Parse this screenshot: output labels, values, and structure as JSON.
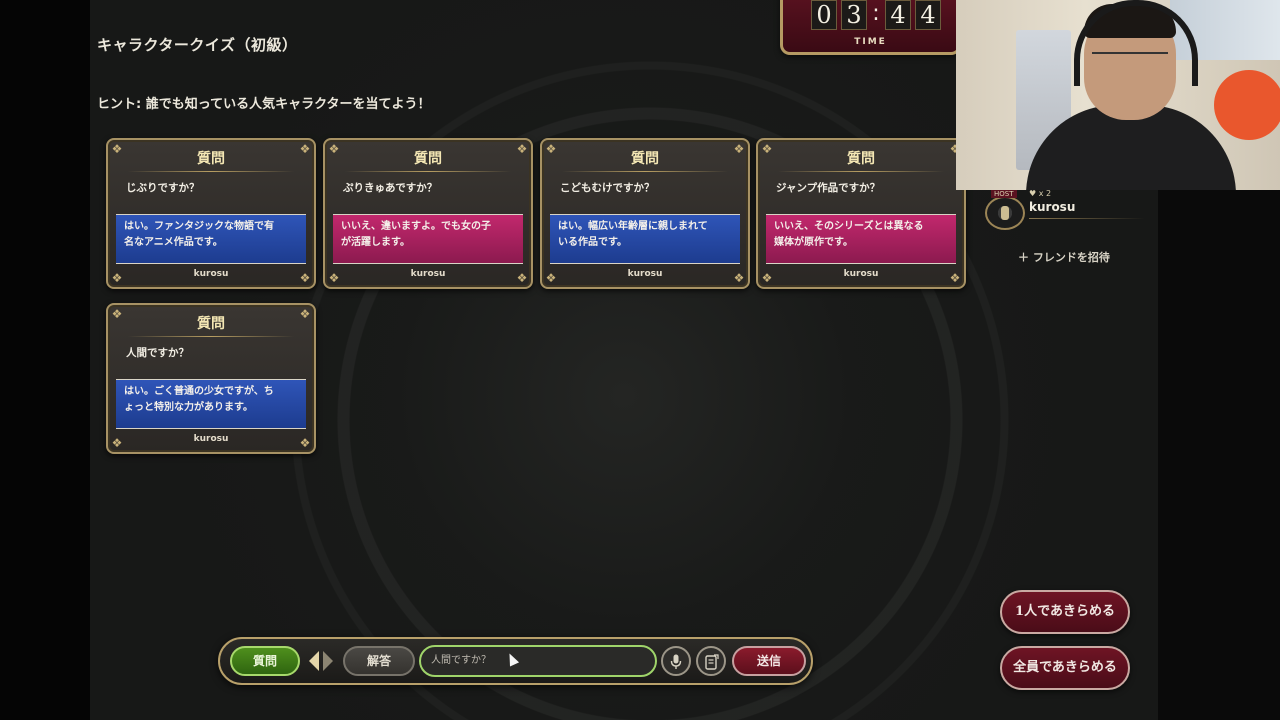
{
  "quiz": {
    "title": "キャラクタークイズ（初級）",
    "hint": "ヒント: 誰でも知っている人気キャラクターを当てよう！"
  },
  "timer": {
    "digits": [
      "0",
      "3",
      "4",
      "4"
    ],
    "separator": ":",
    "label": "TIME"
  },
  "cards": [
    {
      "header": "質問",
      "question": "じぶりですか？",
      "answer_line1": "はい。ファンタジックな物語で有",
      "answer_line2": "名なアニメ作品です。",
      "result": "yes",
      "author": "kurosu"
    },
    {
      "header": "質問",
      "question": "ぷりきゅあですか？",
      "answer_line1": "いいえ、違いますよ。でも女の子",
      "answer_line2": "が活躍します。",
      "result": "no",
      "author": "kurosu"
    },
    {
      "header": "質問",
      "question": "こどもむけですか？",
      "answer_line1": "はい。幅広い年齢層に親しまれて",
      "answer_line2": "いる作品です。",
      "result": "yes",
      "author": "kurosu"
    },
    {
      "header": "質問",
      "question": "ジャンプ作品ですか？",
      "answer_line1": "いいえ、そのシリーズとは異なる",
      "answer_line2": "媒体が原作です。",
      "result": "no",
      "author": "kurosu"
    },
    {
      "header": "質問",
      "question": "人間ですか？",
      "answer_line1": "はい。ごく普通の少女ですが、ち",
      "answer_line2": "ょっと特別な力があります。",
      "result": "yes",
      "author": "kurosu"
    }
  ],
  "player": {
    "host_tag": "HOST",
    "hearts": "♥ x 2",
    "name": "kurosu"
  },
  "invite_label": "＋ フレンドを招待",
  "buttons": {
    "giveup_solo": "1人であきらめる",
    "giveup_all": "全員であきらめる"
  },
  "input_bar": {
    "question_label": "質問",
    "answer_label": "解答",
    "input_value": "人間ですか？",
    "send_label": "送信"
  },
  "colors": {
    "yes_answer": "#2f55b8",
    "no_answer": "#c2286d",
    "question_toggle": "#4f8f1d",
    "send": "#8a1b2c"
  }
}
